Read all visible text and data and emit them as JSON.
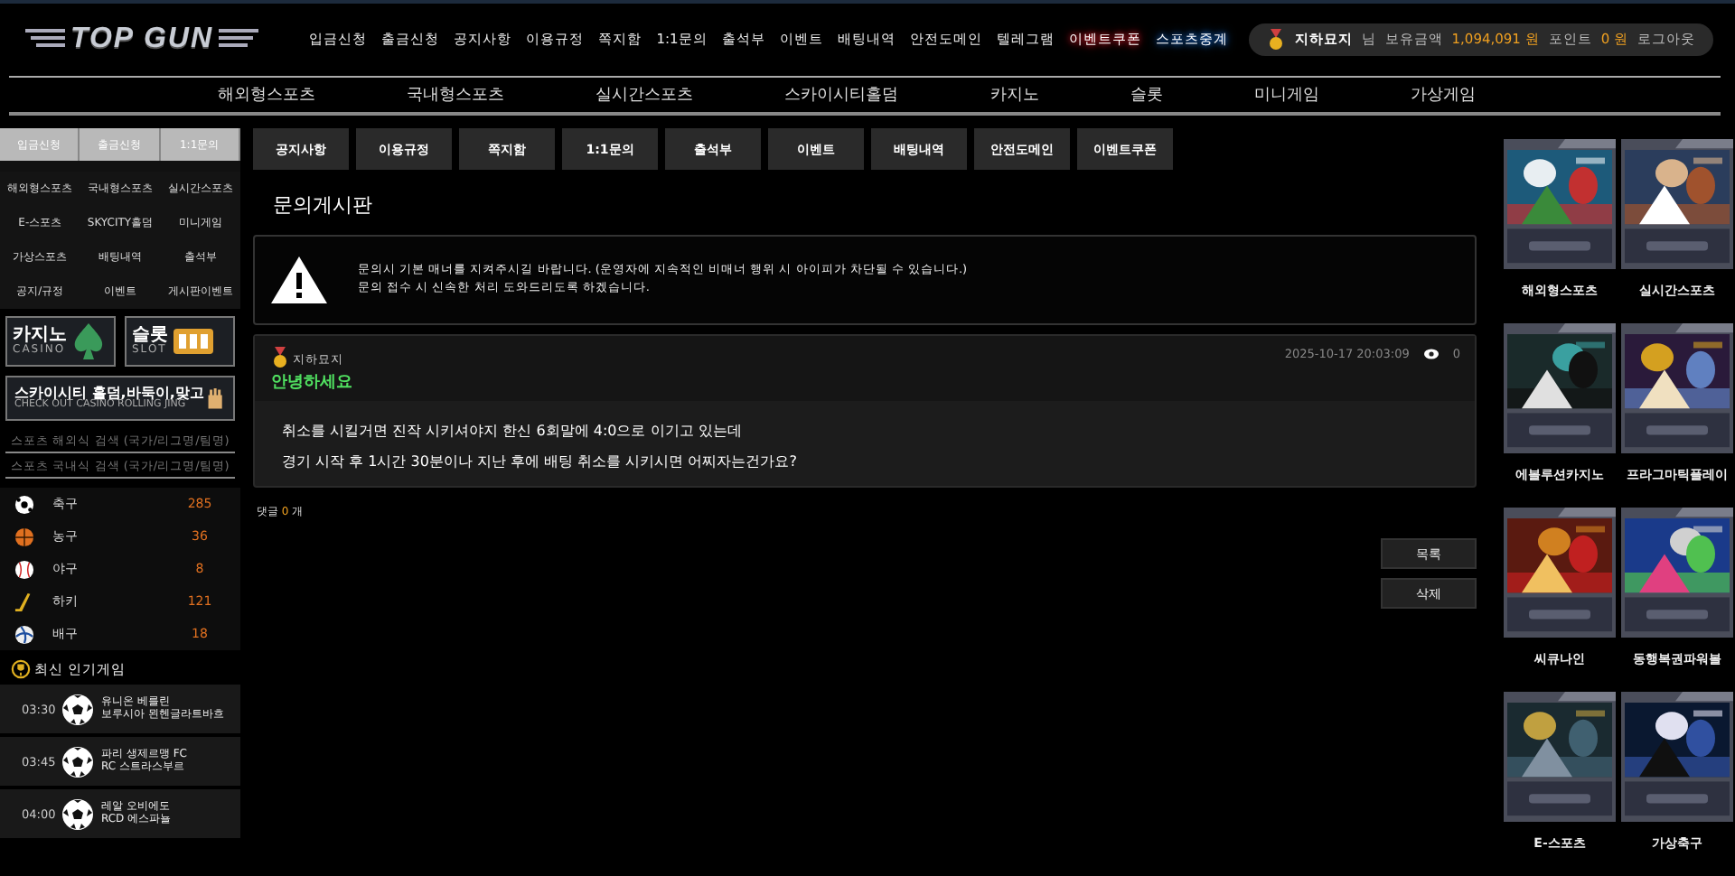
{
  "header": {
    "logo": "TOP GUN",
    "links": [
      {
        "label": "입금신청",
        "kind": "link"
      },
      {
        "label": "출금신청",
        "kind": "link"
      },
      {
        "label": "공지사항",
        "kind": "link"
      },
      {
        "label": "이용규정",
        "kind": "link"
      },
      {
        "label": "쪽지함",
        "kind": "link"
      },
      {
        "label": "1:1문의",
        "kind": "link"
      },
      {
        "label": "출석부",
        "kind": "link"
      },
      {
        "label": "이벤트",
        "kind": "link"
      },
      {
        "label": "배팅내역",
        "kind": "link"
      },
      {
        "label": "안전도메인",
        "kind": "link"
      },
      {
        "label": "텔레그램",
        "kind": "link"
      },
      {
        "label": "이벤트쿠폰",
        "kind": "glow-red"
      },
      {
        "label": "스포츠중계",
        "kind": "glow-blue"
      }
    ],
    "user": {
      "name": "지하묘지",
      "suffix": "님",
      "balance_label": "보유금액",
      "balance": "1,094,091 원",
      "points_label": "포인트",
      "points": "0 원",
      "logout": "로그아웃"
    }
  },
  "main_nav": [
    "해외형스포츠",
    "국내형스포츠",
    "실시간스포츠",
    "스카이시티홀덤",
    "카지노",
    "슬롯",
    "미니게임",
    "가상게임"
  ],
  "sidebar": {
    "quick": [
      {
        "label": "입금신청",
        "kind": "primary"
      },
      {
        "label": "출금신청",
        "kind": "primary"
      },
      {
        "label": "1:1문의",
        "kind": "primary"
      },
      {
        "label": "해외형스포츠",
        "kind": "menu"
      },
      {
        "label": "국내형스포츠",
        "kind": "menu"
      },
      {
        "label": "실시간스포츠",
        "kind": "menu"
      },
      {
        "label": "E-스포츠",
        "kind": "menu"
      },
      {
        "label": "SKYCITY홀덤",
        "kind": "menu"
      },
      {
        "label": "미니게임",
        "kind": "menu"
      },
      {
        "label": "가상스포츠",
        "kind": "menu"
      },
      {
        "label": "배팅내역",
        "kind": "menu"
      },
      {
        "label": "출석부",
        "kind": "menu"
      },
      {
        "label": "공지/규정",
        "kind": "menu"
      },
      {
        "label": "이벤트",
        "kind": "menu"
      },
      {
        "label": "게시판이벤트",
        "kind": "menu"
      }
    ],
    "banners": [
      {
        "title": "카지노",
        "subtitle": "CASINO"
      },
      {
        "title": "슬롯",
        "subtitle": "SLOT"
      }
    ],
    "wide_banner": {
      "title": "스카이시티 홀덤,바둑이,맞고",
      "subtitle": "CHECK OUT CASINO ROLLING JING"
    },
    "searches": [
      {
        "placeholder": "스포츠 해외식 검색 (국가/리그명/팀명)"
      },
      {
        "placeholder": "스포츠 국내식 검색 (국가/리그명/팀명)"
      }
    ],
    "sports": [
      {
        "name": "축구",
        "count": "285"
      },
      {
        "name": "농구",
        "count": "36"
      },
      {
        "name": "야구",
        "count": "8"
      },
      {
        "name": "하키",
        "count": "121"
      },
      {
        "name": "배구",
        "count": "18"
      }
    ],
    "popular_title": "최신 인기게임",
    "matches": [
      {
        "time": "03:30",
        "home": "유니온 베를린",
        "away": "보루시아 묀헨글라트바흐"
      },
      {
        "time": "03:45",
        "home": "파리 생제르맹 FC",
        "away": "RC 스트라스부르"
      },
      {
        "time": "04:00",
        "home": "레알 오비에도",
        "away": "RCD 에스파뇰"
      }
    ]
  },
  "board_tabs": [
    "공지사항",
    "이용규정",
    "쪽지함",
    "1:1문의",
    "출석부",
    "이벤트",
    "배팅내역",
    "안전도메인",
    "이벤트쿠폰"
  ],
  "board_title": "문의게시판",
  "notice": [
    "문의시 기본 매너를 지켜주시길 바랍니다. (운영자에 지속적인 비매너 행위 시 아이피가 차단될 수 있습니다.)",
    "문의 접수 시 신속한 처리 도와드리도록 하겠습니다."
  ],
  "post": {
    "author": "지하묘지",
    "title": "안녕하세요",
    "date": "2025-10-17 20:03:09",
    "views": "0",
    "body": [
      "취소를 시킬거면 진작 시키셔야지 한신 6회말에 4:0으로 이기고 있는데",
      "경기 시작 후 1시간 30분이나 지난 후에 배팅 취소를 시키시면 어찌자는건가요?"
    ]
  },
  "comments": {
    "label": "댓글",
    "count": "0",
    "unit": "개"
  },
  "actions": [
    "목록",
    "삭제"
  ],
  "games": [
    {
      "caption": "해외형스포츠"
    },
    {
      "caption": "실시간스포츠"
    },
    {
      "caption": "에볼루션카지노"
    },
    {
      "caption": "프라그마틱플레이"
    },
    {
      "caption": "씨큐나인"
    },
    {
      "caption": "동행복권파워볼"
    },
    {
      "caption": "E-스포츠"
    },
    {
      "caption": "가상축구"
    }
  ]
}
